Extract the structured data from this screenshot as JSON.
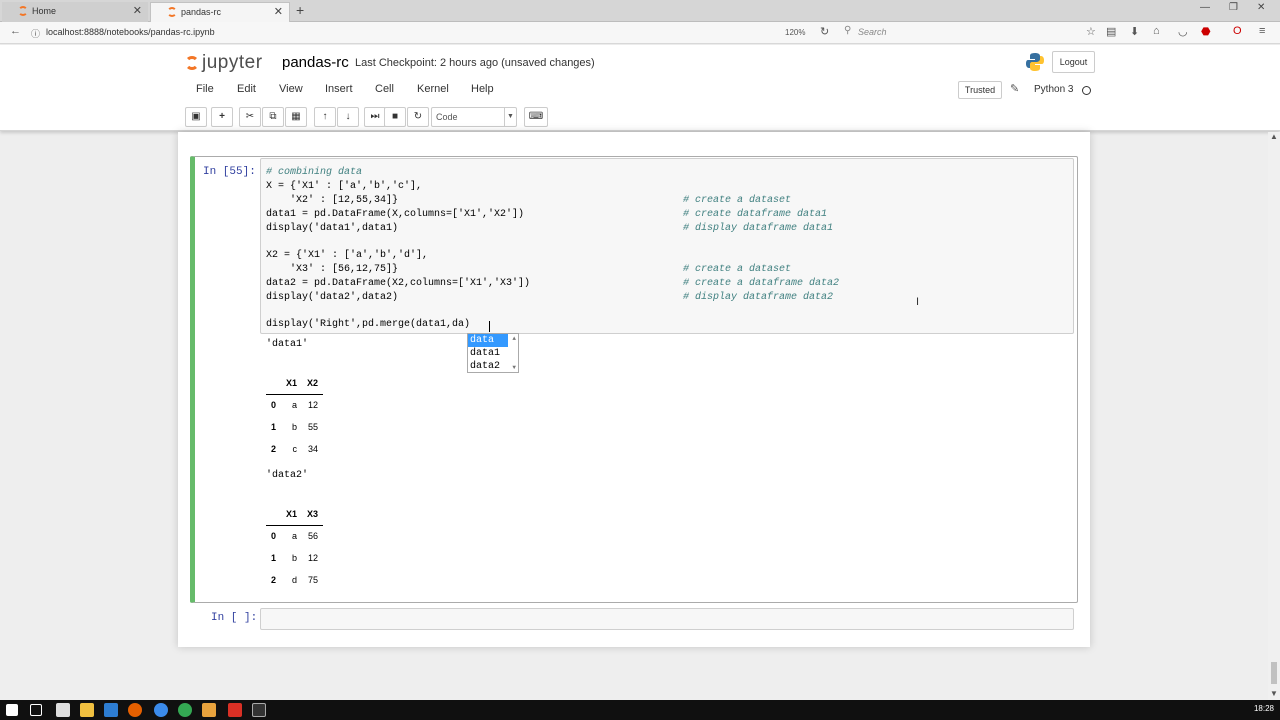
{
  "browser": {
    "tabs": [
      {
        "label": "Home",
        "active": false
      },
      {
        "label": "pandas-rc",
        "active": true
      }
    ],
    "url": "localhost:8888/notebooks/pandas-rc.ipynb",
    "zoom": "120%",
    "search_placeholder": "Search"
  },
  "jupyter": {
    "logo_text": "jupyter",
    "notebook_name": "pandas-rc",
    "checkpoint": "Last Checkpoint: 2 hours ago (unsaved changes)",
    "logout_label": "Logout",
    "menu": [
      "File",
      "Edit",
      "View",
      "Insert",
      "Cell",
      "Kernel",
      "Help"
    ],
    "trusted_label": "Trusted",
    "kernel_name": "Python 3",
    "cell_type": "Code"
  },
  "cell": {
    "prompt": "In [55]:",
    "code_lines": [
      {
        "code": "# combining data",
        "comment": ""
      },
      {
        "code": "X = {'X1' : ['a','b','c'],",
        "comment": ""
      },
      {
        "code": "    'X2' : [12,55,34]}",
        "comment": "# create a dataset"
      },
      {
        "code": "data1 = pd.DataFrame(X,columns=['X1','X2'])",
        "comment": "# create dataframe data1"
      },
      {
        "code": "display('data1',data1)",
        "comment": "# display dataframe data1"
      },
      {
        "code": "",
        "comment": ""
      },
      {
        "code": "X2 = {'X1' : ['a','b','d'],",
        "comment": ""
      },
      {
        "code": "    'X3' : [56,12,75]}",
        "comment": "# create a dataset"
      },
      {
        "code": "data2 = pd.DataFrame(X2,columns=['X1','X3'])",
        "comment": "# create a dataframe data2"
      },
      {
        "code": "display('data2',data2)",
        "comment": "# display dataframe data2"
      },
      {
        "code": "",
        "comment": ""
      },
      {
        "code": "display('Right',pd.merge(data1,da)",
        "comment": ""
      }
    ],
    "autocomplete": [
      "data",
      "data1",
      "data2"
    ],
    "outputs": [
      {
        "label": "'data1'",
        "columns": [
          "",
          "X1",
          "X2"
        ],
        "rows": [
          [
            "0",
            "a",
            "12"
          ],
          [
            "1",
            "b",
            "55"
          ],
          [
            "2",
            "c",
            "34"
          ]
        ]
      },
      {
        "label": "'data2'",
        "columns": [
          "",
          "X1",
          "X3"
        ],
        "rows": [
          [
            "0",
            "a",
            "56"
          ],
          [
            "1",
            "b",
            "12"
          ],
          [
            "2",
            "d",
            "75"
          ]
        ]
      }
    ]
  },
  "empty_cell": {
    "prompt": "In [ ]:"
  },
  "taskbar": {
    "clock": "18:28"
  },
  "colors": {
    "accent": "#f37626",
    "cell_border": "#66bb6a",
    "prompt": "#303f9f"
  }
}
